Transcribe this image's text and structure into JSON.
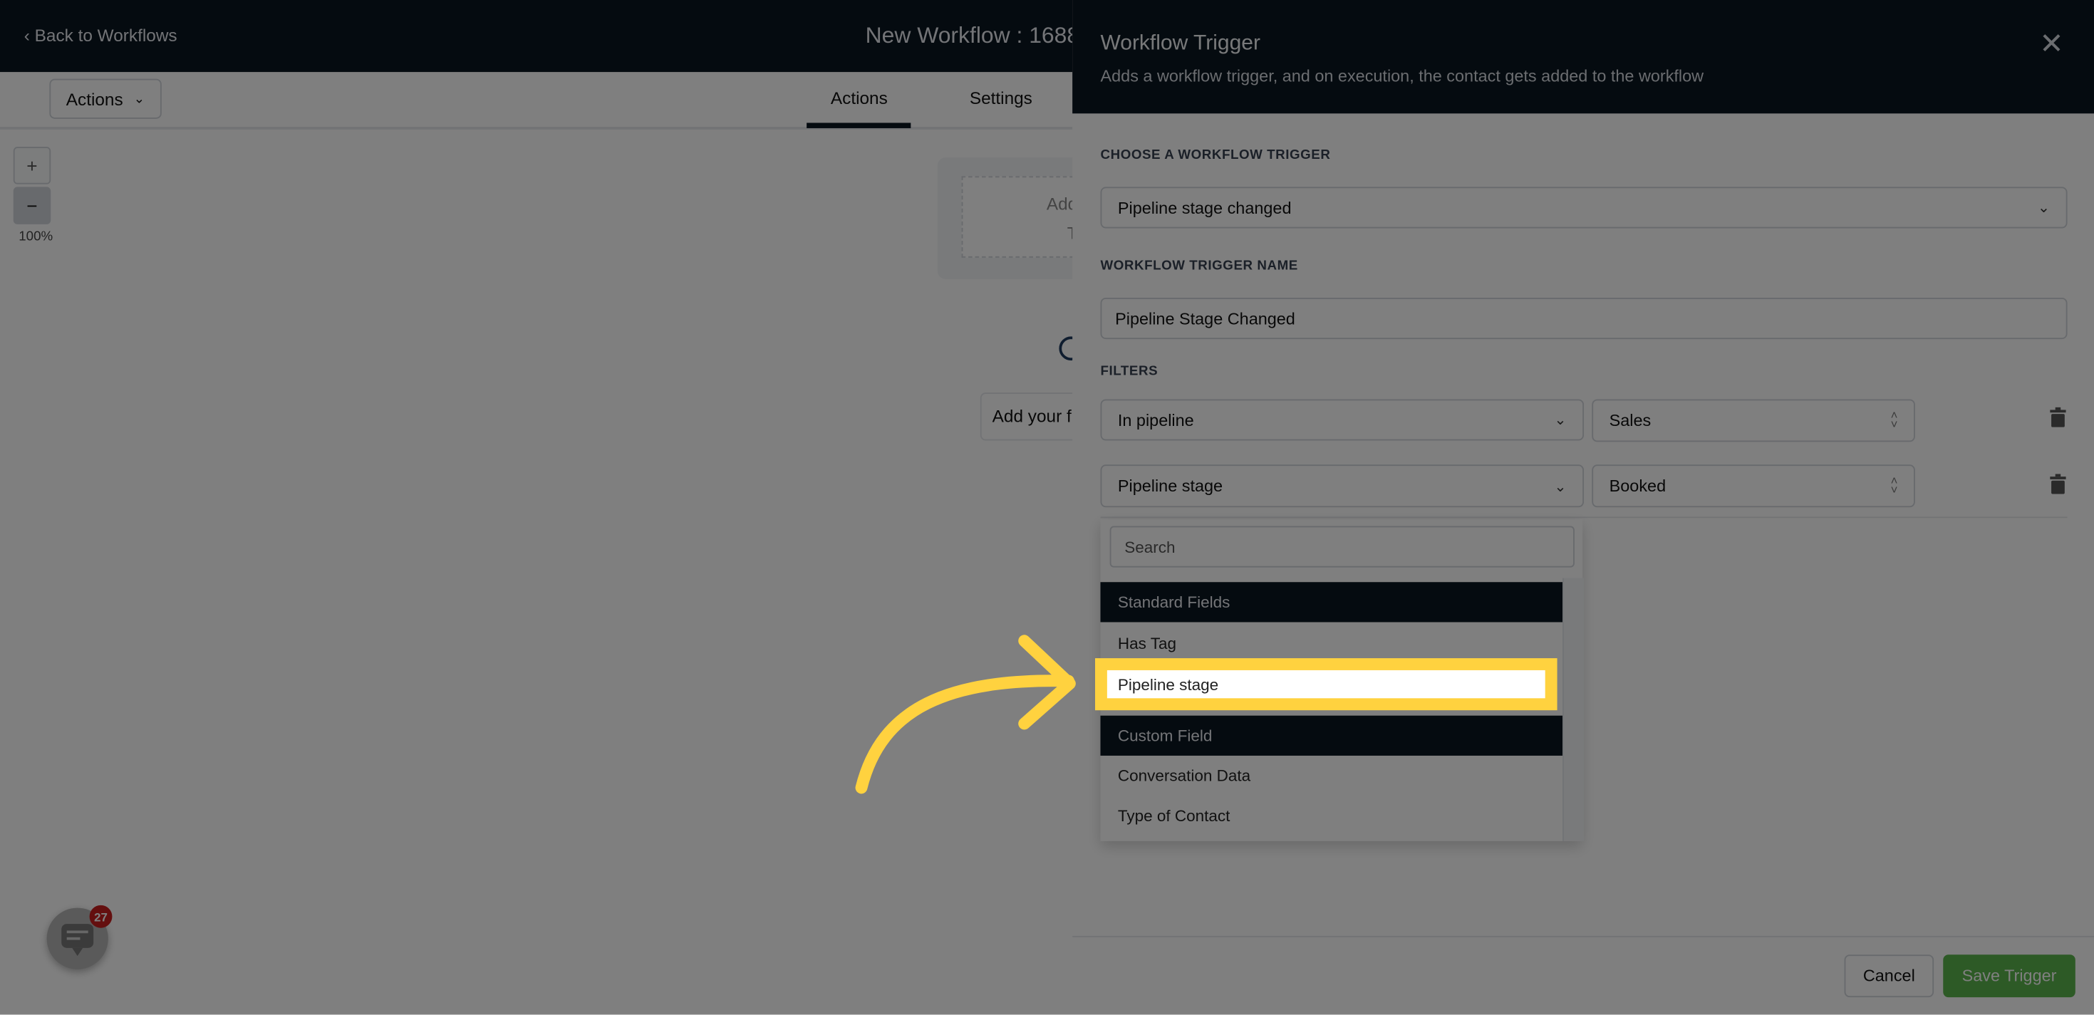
{
  "header": {
    "back_label": "Back to Workflows",
    "title": "New Workflow : 1688"
  },
  "toolbar": {
    "actions_dropdown": "Actions",
    "tabs": [
      {
        "label": "Actions",
        "active": true
      },
      {
        "label": "Settings",
        "active": false
      }
    ]
  },
  "canvas": {
    "zoom_in": "+",
    "zoom_out": "−",
    "zoom_level": "100%",
    "trigger_card_line1": "Add New",
    "trigger_card_line2": "Trig",
    "add_action_text": "Add your f"
  },
  "panel": {
    "title": "Workflow Trigger",
    "subtitle": "Adds a workflow trigger, and on execution, the contact gets added to the workflow",
    "choose_label": "CHOOSE A WORKFLOW TRIGGER",
    "trigger_value": "Pipeline stage changed",
    "name_label": "WORKFLOW TRIGGER NAME",
    "name_value": "Pipeline Stage Changed",
    "filters_label": "FILTERS",
    "filters": [
      {
        "field": "In pipeline",
        "value": "Sales"
      },
      {
        "field": "Pipeline stage",
        "value": "Booked"
      }
    ],
    "dropdown": {
      "search_placeholder": "Search",
      "items": [
        {
          "label": "Standard Fields",
          "group": true
        },
        {
          "label": "Has Tag"
        },
        {
          "label": "Pipeline stage",
          "highlighted": true
        },
        {
          "label": "Custom Field",
          "group": true
        },
        {
          "label": "Conversation Data"
        },
        {
          "label": "Type of Contact"
        }
      ]
    },
    "cancel_label": "Cancel",
    "save_label": "Save Trigger"
  },
  "chat_widget": {
    "badge_count": "27"
  },
  "colors": {
    "header_bg": "#0b1621",
    "highlight": "#ffd23f",
    "save_green": "#5ab44c",
    "badge_red": "#c81e1e"
  }
}
